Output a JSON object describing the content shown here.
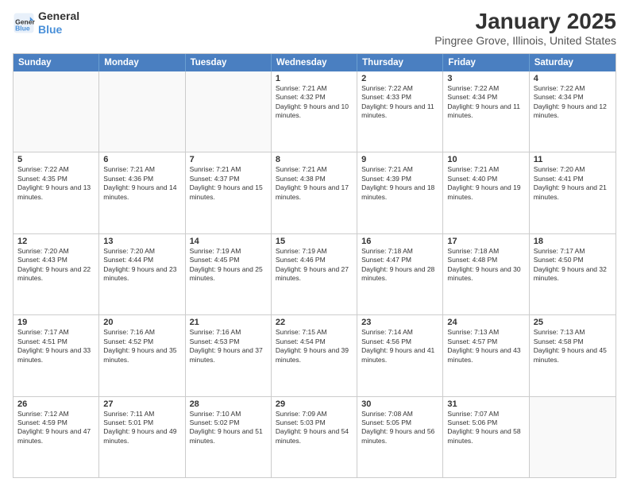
{
  "logo": {
    "line1": "General",
    "line2": "Blue"
  },
  "title": "January 2025",
  "subtitle": "Pingree Grove, Illinois, United States",
  "days_of_week": [
    "Sunday",
    "Monday",
    "Tuesday",
    "Wednesday",
    "Thursday",
    "Friday",
    "Saturday"
  ],
  "weeks": [
    [
      {
        "day": "",
        "text": ""
      },
      {
        "day": "",
        "text": ""
      },
      {
        "day": "",
        "text": ""
      },
      {
        "day": "1",
        "text": "Sunrise: 7:21 AM\nSunset: 4:32 PM\nDaylight: 9 hours and 10 minutes."
      },
      {
        "day": "2",
        "text": "Sunrise: 7:22 AM\nSunset: 4:33 PM\nDaylight: 9 hours and 11 minutes."
      },
      {
        "day": "3",
        "text": "Sunrise: 7:22 AM\nSunset: 4:34 PM\nDaylight: 9 hours and 11 minutes."
      },
      {
        "day": "4",
        "text": "Sunrise: 7:22 AM\nSunset: 4:34 PM\nDaylight: 9 hours and 12 minutes."
      }
    ],
    [
      {
        "day": "5",
        "text": "Sunrise: 7:22 AM\nSunset: 4:35 PM\nDaylight: 9 hours and 13 minutes."
      },
      {
        "day": "6",
        "text": "Sunrise: 7:21 AM\nSunset: 4:36 PM\nDaylight: 9 hours and 14 minutes."
      },
      {
        "day": "7",
        "text": "Sunrise: 7:21 AM\nSunset: 4:37 PM\nDaylight: 9 hours and 15 minutes."
      },
      {
        "day": "8",
        "text": "Sunrise: 7:21 AM\nSunset: 4:38 PM\nDaylight: 9 hours and 17 minutes."
      },
      {
        "day": "9",
        "text": "Sunrise: 7:21 AM\nSunset: 4:39 PM\nDaylight: 9 hours and 18 minutes."
      },
      {
        "day": "10",
        "text": "Sunrise: 7:21 AM\nSunset: 4:40 PM\nDaylight: 9 hours and 19 minutes."
      },
      {
        "day": "11",
        "text": "Sunrise: 7:20 AM\nSunset: 4:41 PM\nDaylight: 9 hours and 21 minutes."
      }
    ],
    [
      {
        "day": "12",
        "text": "Sunrise: 7:20 AM\nSunset: 4:43 PM\nDaylight: 9 hours and 22 minutes."
      },
      {
        "day": "13",
        "text": "Sunrise: 7:20 AM\nSunset: 4:44 PM\nDaylight: 9 hours and 23 minutes."
      },
      {
        "day": "14",
        "text": "Sunrise: 7:19 AM\nSunset: 4:45 PM\nDaylight: 9 hours and 25 minutes."
      },
      {
        "day": "15",
        "text": "Sunrise: 7:19 AM\nSunset: 4:46 PM\nDaylight: 9 hours and 27 minutes."
      },
      {
        "day": "16",
        "text": "Sunrise: 7:18 AM\nSunset: 4:47 PM\nDaylight: 9 hours and 28 minutes."
      },
      {
        "day": "17",
        "text": "Sunrise: 7:18 AM\nSunset: 4:48 PM\nDaylight: 9 hours and 30 minutes."
      },
      {
        "day": "18",
        "text": "Sunrise: 7:17 AM\nSunset: 4:50 PM\nDaylight: 9 hours and 32 minutes."
      }
    ],
    [
      {
        "day": "19",
        "text": "Sunrise: 7:17 AM\nSunset: 4:51 PM\nDaylight: 9 hours and 33 minutes."
      },
      {
        "day": "20",
        "text": "Sunrise: 7:16 AM\nSunset: 4:52 PM\nDaylight: 9 hours and 35 minutes."
      },
      {
        "day": "21",
        "text": "Sunrise: 7:16 AM\nSunset: 4:53 PM\nDaylight: 9 hours and 37 minutes."
      },
      {
        "day": "22",
        "text": "Sunrise: 7:15 AM\nSunset: 4:54 PM\nDaylight: 9 hours and 39 minutes."
      },
      {
        "day": "23",
        "text": "Sunrise: 7:14 AM\nSunset: 4:56 PM\nDaylight: 9 hours and 41 minutes."
      },
      {
        "day": "24",
        "text": "Sunrise: 7:13 AM\nSunset: 4:57 PM\nDaylight: 9 hours and 43 minutes."
      },
      {
        "day": "25",
        "text": "Sunrise: 7:13 AM\nSunset: 4:58 PM\nDaylight: 9 hours and 45 minutes."
      }
    ],
    [
      {
        "day": "26",
        "text": "Sunrise: 7:12 AM\nSunset: 4:59 PM\nDaylight: 9 hours and 47 minutes."
      },
      {
        "day": "27",
        "text": "Sunrise: 7:11 AM\nSunset: 5:01 PM\nDaylight: 9 hours and 49 minutes."
      },
      {
        "day": "28",
        "text": "Sunrise: 7:10 AM\nSunset: 5:02 PM\nDaylight: 9 hours and 51 minutes."
      },
      {
        "day": "29",
        "text": "Sunrise: 7:09 AM\nSunset: 5:03 PM\nDaylight: 9 hours and 54 minutes."
      },
      {
        "day": "30",
        "text": "Sunrise: 7:08 AM\nSunset: 5:05 PM\nDaylight: 9 hours and 56 minutes."
      },
      {
        "day": "31",
        "text": "Sunrise: 7:07 AM\nSunset: 5:06 PM\nDaylight: 9 hours and 58 minutes."
      },
      {
        "day": "",
        "text": ""
      }
    ]
  ]
}
